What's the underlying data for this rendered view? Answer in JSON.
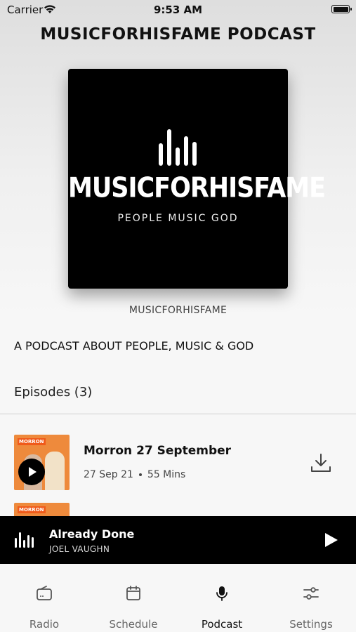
{
  "status_bar": {
    "carrier": "Carrier",
    "time": "9:53 AM"
  },
  "header": {
    "title": "MUSICFORHISFAME PODCAST"
  },
  "podcast": {
    "cover_brand": "MUSICFORHISFAME",
    "cover_tagline": "PEOPLE MUSIC GOD",
    "author": "MUSICFORHISFAME",
    "description": "A PODCAST ABOUT PEOPLE, MUSIC & GOD"
  },
  "episodes": {
    "heading": "Episodes (3)",
    "items": [
      {
        "title": "Morron 27 September",
        "date": "27 Sep 21",
        "duration": "55 Mins",
        "thumb_label": "MORRON"
      },
      {
        "thumb_label": "MORRON"
      }
    ]
  },
  "now_playing": {
    "title": "Already Done",
    "artist": "JOEL VAUGHN"
  },
  "tabs": [
    {
      "label": "Radio",
      "icon": "radio-icon",
      "active": false
    },
    {
      "label": "Schedule",
      "icon": "calendar-icon",
      "active": false
    },
    {
      "label": "Podcast",
      "icon": "microphone-icon",
      "active": true
    },
    {
      "label": "Settings",
      "icon": "sliders-icon",
      "active": false
    }
  ]
}
